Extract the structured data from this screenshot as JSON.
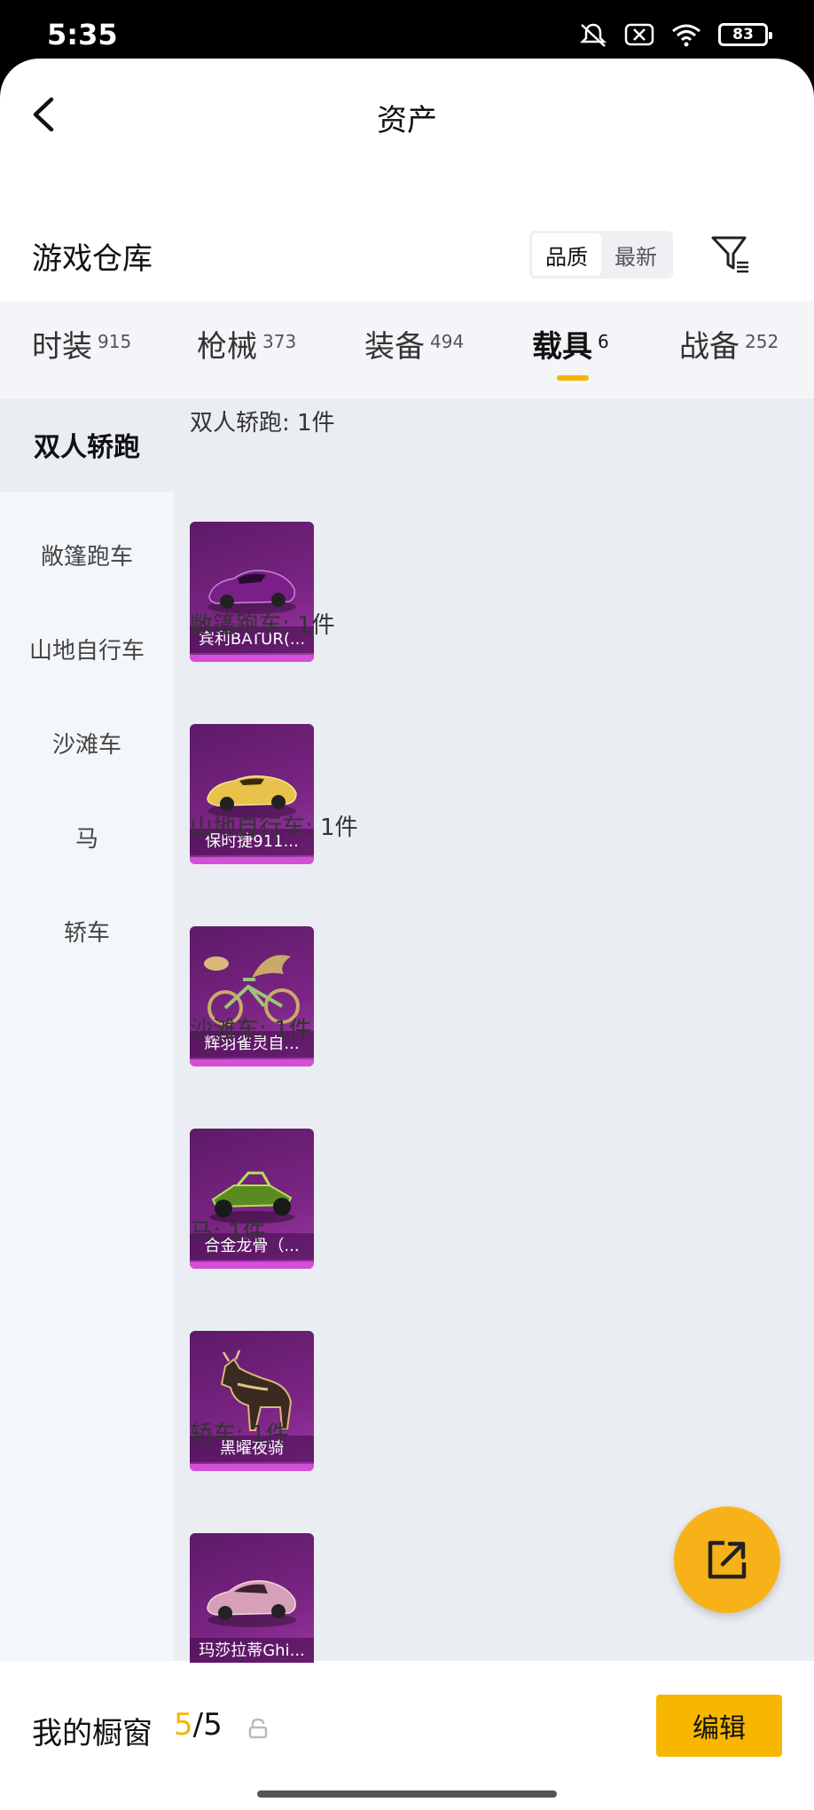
{
  "status": {
    "time": "5:35",
    "battery": "83"
  },
  "nav": {
    "title": "资产"
  },
  "section": {
    "title": "游戏仓库",
    "sort_options": [
      "品质",
      "最新"
    ]
  },
  "tabs": [
    {
      "label": "时装",
      "count": "915"
    },
    {
      "label": "枪械",
      "count": "373"
    },
    {
      "label": "装备",
      "count": "494"
    },
    {
      "label": "载具",
      "count": "6"
    },
    {
      "label": "战备",
      "count": "252"
    }
  ],
  "sidebar": [
    "双人轿跑",
    "敞篷跑车",
    "山地自行车",
    "沙滩车",
    "马",
    "轿车"
  ],
  "groups": [
    {
      "title": "双人轿跑: 1件",
      "item": "宾利BATUR(...",
      "icon": "purple-sports-car"
    },
    {
      "title": "敞篷跑车: 1件",
      "item": "保时捷911...",
      "icon": "yellow-convertible"
    },
    {
      "title": "山地自行车: 1件",
      "item": "辉羽雀灵自...",
      "icon": "winged-bicycle"
    },
    {
      "title": "沙滩车: 1件",
      "item": "合金龙骨（...",
      "icon": "green-buggy"
    },
    {
      "title": "马: 1件",
      "item": "黑曜夜骑",
      "icon": "armored-horse"
    },
    {
      "title": "轿车: 1件",
      "item": "玛莎拉蒂Ghi...",
      "icon": "pink-sedan"
    }
  ],
  "bottom": {
    "label": "我的橱窗",
    "current": "5",
    "sep_total": "/5",
    "edit": "编辑"
  }
}
